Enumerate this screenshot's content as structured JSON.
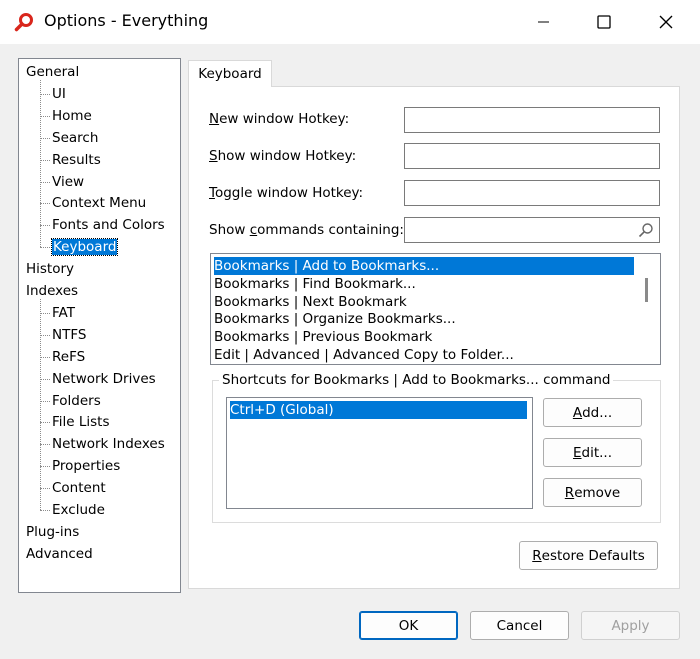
{
  "window": {
    "title": "Options - Everything"
  },
  "tree": {
    "items": [
      {
        "label": "General",
        "level": 0
      },
      {
        "label": "UI",
        "level": 1
      },
      {
        "label": "Home",
        "level": 1
      },
      {
        "label": "Search",
        "level": 1
      },
      {
        "label": "Results",
        "level": 1
      },
      {
        "label": "View",
        "level": 1
      },
      {
        "label": "Context Menu",
        "level": 1
      },
      {
        "label": "Fonts and Colors",
        "level": 1
      },
      {
        "label": "Keyboard",
        "level": 1,
        "selected": true
      },
      {
        "label": "History",
        "level": 0
      },
      {
        "label": "Indexes",
        "level": 0
      },
      {
        "label": "FAT",
        "level": 1
      },
      {
        "label": "NTFS",
        "level": 1
      },
      {
        "label": "ReFS",
        "level": 1
      },
      {
        "label": "Network Drives",
        "level": 1
      },
      {
        "label": "Folders",
        "level": 1
      },
      {
        "label": "File Lists",
        "level": 1
      },
      {
        "label": "Network Indexes",
        "level": 1
      },
      {
        "label": "Properties",
        "level": 1
      },
      {
        "label": "Content",
        "level": 1
      },
      {
        "label": "Exclude",
        "level": 1
      },
      {
        "label": "Plug-ins",
        "level": 0
      },
      {
        "label": "Advanced",
        "level": 0
      }
    ]
  },
  "tab": {
    "label": "Keyboard"
  },
  "fields": {
    "new_window": {
      "ul": "N",
      "rest": "ew window Hotkey:",
      "value": ""
    },
    "show_window": {
      "ul": "S",
      "rest": "how window Hotkey:",
      "value": ""
    },
    "toggle_window": {
      "ul": "T",
      "rest": "oggle window Hotkey:",
      "value": ""
    },
    "show_commands": {
      "pre": "Show ",
      "ul": "c",
      "rest": "ommands containing:",
      "value": ""
    }
  },
  "commands": [
    {
      "label": "Bookmarks | Add to Bookmarks...",
      "selected": true
    },
    {
      "label": "Bookmarks | Find Bookmark..."
    },
    {
      "label": "Bookmarks | Next Bookmark"
    },
    {
      "label": "Bookmarks | Organize Bookmarks..."
    },
    {
      "label": "Bookmarks | Previous Bookmark"
    },
    {
      "label": "Edit | Advanced | Advanced Copy to Folder..."
    }
  ],
  "shortcuts": {
    "title": "Shortcuts for Bookmarks | Add to Bookmarks... command",
    "items": [
      {
        "label": "Ctrl+D (Global)",
        "selected": true
      }
    ],
    "add": {
      "ul": "A",
      "rest": "dd..."
    },
    "edit": {
      "ul": "E",
      "rest": "dit..."
    },
    "remove": {
      "ul": "R",
      "rest": "emove"
    }
  },
  "restore": {
    "ul": "R",
    "rest": "estore Defaults"
  },
  "footer": {
    "ok": "OK",
    "cancel": "Cancel",
    "apply": "Apply"
  },
  "colors": {
    "selection": "#0078d7",
    "accent_border": "#0067c0",
    "icon_red": "#d9261c"
  }
}
